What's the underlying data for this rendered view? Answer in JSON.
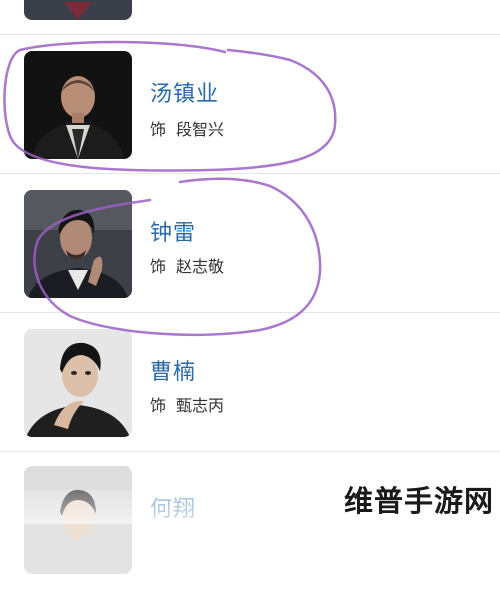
{
  "cast": [
    {
      "actor": "",
      "role_prefix": "",
      "character": ""
    },
    {
      "actor": "汤镇业",
      "role_prefix": "饰",
      "character": "段智兴"
    },
    {
      "actor": "钟雷",
      "role_prefix": "饰",
      "character": "赵志敬"
    },
    {
      "actor": "曹楠",
      "role_prefix": "饰",
      "character": "甄志丙"
    },
    {
      "actor": "何翔",
      "role_prefix": "",
      "character": ""
    }
  ],
  "watermark": "维普手游网",
  "colors": {
    "name": "#2b6aa7",
    "role": "#333333",
    "divider": "#e5e5e5",
    "annotation": "#9a5fc4"
  }
}
